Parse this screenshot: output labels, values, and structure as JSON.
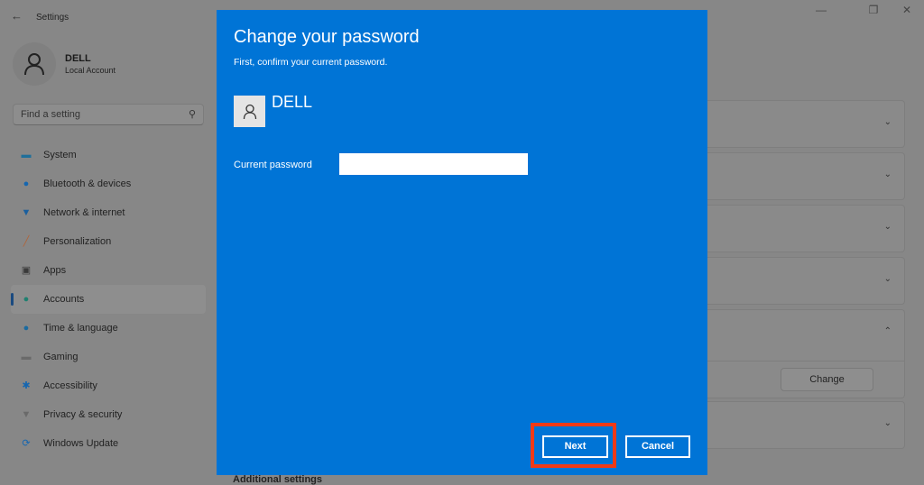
{
  "window": {
    "title": "Settings",
    "back_icon": "arrow-left-icon",
    "controls": [
      "minimize",
      "restore",
      "close"
    ]
  },
  "user": {
    "name": "DELL",
    "type": "Local Account"
  },
  "search": {
    "placeholder": "Find a setting"
  },
  "sidebar": {
    "items": [
      {
        "label": "System",
        "icon": "monitor-icon",
        "color": "#1f6f9a"
      },
      {
        "label": "Bluetooth & devices",
        "icon": "bluetooth-icon",
        "color": "#1566b0"
      },
      {
        "label": "Network & internet",
        "icon": "wifi-icon",
        "color": "#1a5f9e"
      },
      {
        "label": "Personalization",
        "icon": "brush-icon",
        "color": "#b0653a"
      },
      {
        "label": "Apps",
        "icon": "apps-icon",
        "color": "#3a3a3a"
      },
      {
        "label": "Accounts",
        "icon": "person-icon",
        "color": "#1f8070",
        "selected": true
      },
      {
        "label": "Time & language",
        "icon": "globe-clock-icon",
        "color": "#1a6aa0"
      },
      {
        "label": "Gaming",
        "icon": "gamepad-icon",
        "color": "#6a6a6a"
      },
      {
        "label": "Accessibility",
        "icon": "accessibility-icon",
        "color": "#1566b0"
      },
      {
        "label": "Privacy & security",
        "icon": "shield-icon",
        "color": "#6a6a6a"
      },
      {
        "label": "Windows Update",
        "icon": "update-icon",
        "color": "#1566b0"
      }
    ]
  },
  "main": {
    "change_button": "Change",
    "additional_settings": "Additional settings"
  },
  "dialog": {
    "title": "Change your password",
    "subtitle": "First, confirm your current password.",
    "username": "DELL",
    "current_password_label": "Current password",
    "current_password_value": "",
    "next_label": "Next",
    "cancel_label": "Cancel",
    "background_color": "#0074d6",
    "highlight_color": "#f03a17"
  }
}
